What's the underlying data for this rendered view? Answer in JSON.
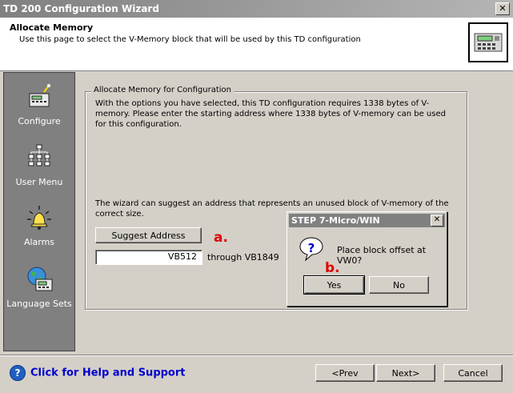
{
  "window": {
    "title": "TD 200 Configuration Wizard",
    "close_glyph": "✕"
  },
  "header": {
    "title": "Allocate Memory",
    "subtitle": "Use this page to select the V-Memory block that will be used by this TD configuration"
  },
  "sidebar": {
    "items": [
      {
        "label": "Configure",
        "icon": "td-device-icon"
      },
      {
        "label": "User Menu",
        "icon": "menu-tree-icon"
      },
      {
        "label": "Alarms",
        "icon": "alarm-bell-icon"
      },
      {
        "label": "Language Sets",
        "icon": "globe-icon"
      }
    ]
  },
  "group": {
    "label": "Allocate Memory for Configuration",
    "para1": "With the options you have selected, this TD configuration requires 1338 bytes of V-memory. Please enter the starting address where 1338 bytes of V-memory can be used for this configuration.",
    "para2": "The wizard can suggest an address that represents an unused block of V-memory of the correct size.",
    "suggest_label": "Suggest Address",
    "address_value": "VB512",
    "through_text": "through VB1849"
  },
  "annotations": {
    "a": "a.",
    "b": "b."
  },
  "dialog": {
    "title": "STEP 7-Micro/WIN",
    "message": "Place block offset at VW0?",
    "yes_label": "Yes",
    "no_label": "No",
    "close_glyph": "✕"
  },
  "footer": {
    "help_label": "Click for Help and Support",
    "prev_label": "<Prev",
    "next_label": "Next>",
    "cancel_label": "Cancel"
  },
  "colors": {
    "annotation": "#e00000",
    "help_link": "#0000cc"
  }
}
